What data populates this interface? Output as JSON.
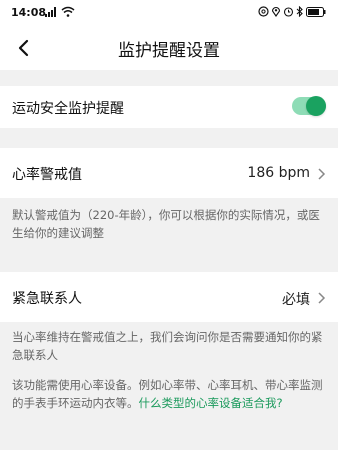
{
  "status_bar": {
    "time": "14:08",
    "left_icons": [
      "signal-icon",
      "wifi-icon"
    ],
    "right_icons": [
      "at-icon",
      "location-icon",
      "alarm-icon",
      "bluetooth-icon",
      "battery-icon"
    ]
  },
  "nav": {
    "title": "监护提醒设置"
  },
  "monitor_row": {
    "label": "运动安全监护提醒",
    "toggle_on": true,
    "toggle_color": "#1aa260"
  },
  "heart_rate_row": {
    "label": "心率警戒值",
    "value": "186 bpm"
  },
  "heart_rate_note": "默认警戒值为（220-年龄），你可以根据你的实际情况，或医生给你的建议调整",
  "emergency_row": {
    "label": "紧急联系人",
    "value": "必填"
  },
  "emergency_note": "当心率维持在警戒值之上，我们会询问你是否需要通知你的紧急联系人",
  "device_note": {
    "text": "该功能需使用心率设备。例如心率带、心率耳机、带心率监测的手表手环运动内衣等。",
    "link": "什么类型的心率设备适合我?"
  }
}
